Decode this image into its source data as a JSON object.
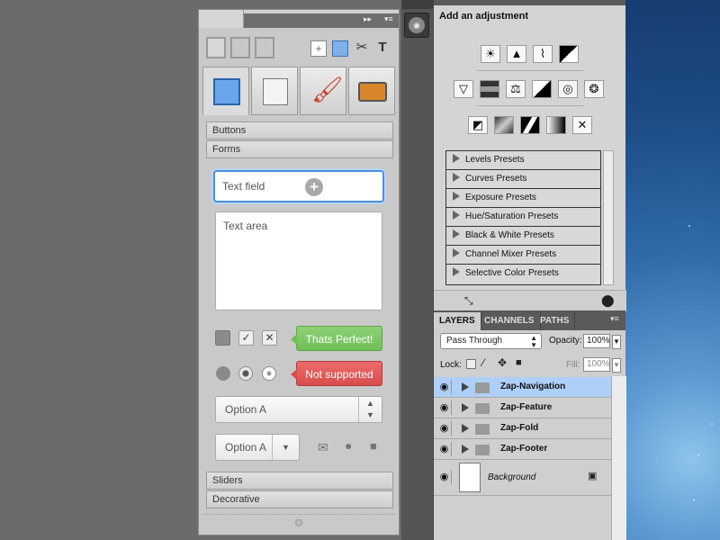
{
  "zap_panel": {
    "sections": {
      "buttons": "Buttons",
      "forms": "Forms",
      "sliders": "Sliders",
      "decorative": "Decorative"
    },
    "text_field_placeholder": "Text field",
    "text_area_placeholder": "Text area",
    "tooltip_success": "Thats Perfect!",
    "tooltip_error": "Not supported",
    "select_a": "Option  A",
    "select_b": "Option  A"
  },
  "adjustments": {
    "header": "Add an adjustment",
    "presets": [
      "Levels Presets",
      "Curves Presets",
      "Exposure Presets",
      "Hue/Saturation Presets",
      "Black & White Presets",
      "Channel Mixer Presets",
      "Selective Color Presets"
    ]
  },
  "layers": {
    "tabs": [
      "LAYERS",
      "CHANNELS",
      "PATHS"
    ],
    "blend_mode": "Pass Through",
    "opacity_label": "Opacity:",
    "opacity_value": "100%",
    "lock_label": "Lock:",
    "fill_label": "Fill:",
    "fill_value": "100%",
    "groups": [
      "Zap-Navigation",
      "Zap-Feature",
      "Zap-Fold",
      "Zap-Footer"
    ],
    "background_layer": "Background"
  },
  "colors": {
    "focus_blue": "#4d8fd9",
    "success_green": "#6fbf57",
    "error_red": "#d94c4c",
    "selected_layer": "#aecff7"
  }
}
